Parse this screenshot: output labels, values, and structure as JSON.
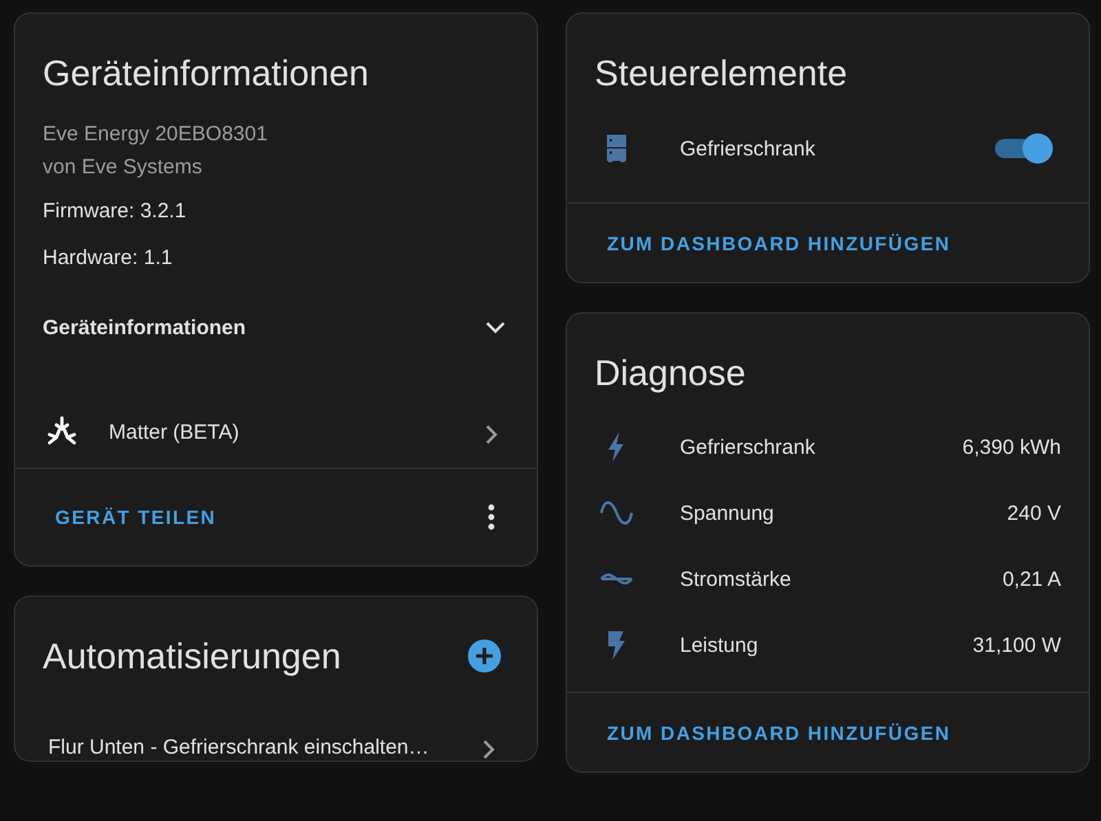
{
  "device_info": {
    "title": "Geräteinformationen",
    "model": "Eve Energy 20EBO8301",
    "manufacturer": "von Eve Systems",
    "firmware": "Firmware: 3.2.1",
    "hardware": "Hardware: 1.1",
    "expander": {
      "label": "Geräteinformationen",
      "expanded": false
    },
    "integration": {
      "label": "Matter (BETA)"
    },
    "action": "GERÄT TEILEN"
  },
  "automations": {
    "title": "Automatisierungen",
    "items": [
      {
        "label": "Flur Unten - Gefrierschrank einschalten…"
      }
    ]
  },
  "controls": {
    "title": "Steuerelemente",
    "items": [
      {
        "label": "Gefrierschrank",
        "on": true
      }
    ],
    "action": "ZUM DASHBOARD HINZUFÜGEN"
  },
  "diagnostics": {
    "title": "Diagnose",
    "items": [
      {
        "kind": "energy",
        "label": "Gefrierschrank",
        "value": "6,390 kWh"
      },
      {
        "kind": "voltage",
        "label": "Spannung",
        "value": "240 V"
      },
      {
        "kind": "current",
        "label": "Stromstärke",
        "value": "0,21 A"
      },
      {
        "kind": "power",
        "label": "Leistung",
        "value": "31,100 W"
      }
    ],
    "action": "ZUM DASHBOARD HINZUFÜGEN"
  }
}
